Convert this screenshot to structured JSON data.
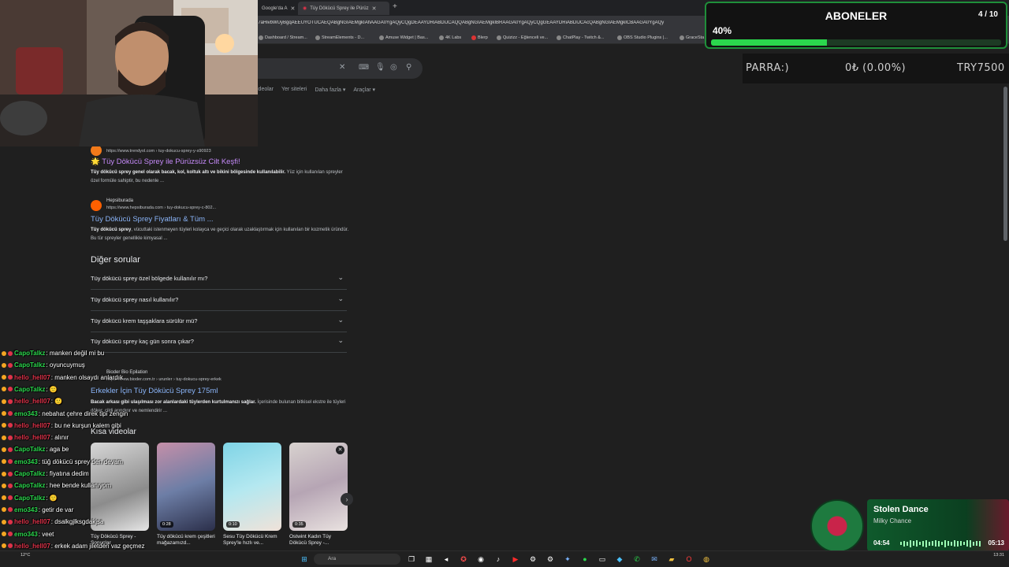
{
  "browser": {
    "tabs": [
      {
        "label": "Google'da A",
        "active": false
      },
      {
        "label": "Tüy Dökücü Sprey ile Pürüz",
        "active": true
      }
    ],
    "url": "j7aHivbWUyBgqAEEUYOTUCAEQABgNGIAEMgkIAhAAGA0YgAQyCQgDEAAYDRiABDIJCAQQABgNGIAEMgkIBRAAGA0YgAQyCQgGEAAYDRiABDIJCAcQABgNGIAEMgkICBAAGA0YgAQy",
    "bookmarks": [
      "Dashboard / Stream...",
      "StreamElements - D...",
      "Amuse Widget | Bas...",
      "4K Labs",
      "Blerp",
      "Quizizz - Eğlenceli ve...",
      "ChatPlay - Twitch &...",
      "OBS Studio Plugins |...",
      "GraceSta"
    ]
  },
  "google": {
    "tabs": [
      "ideolar",
      "Yer siteleri",
      "Daha fazla ▾",
      "Araçlar ▾"
    ],
    "results": [
      {
        "site": "Trendyol",
        "url": "https://www.trendyol.com › tuy-dokucu-sprey-y-s90923",
        "title": "🌟 Tüy Dökücü Sprey ile Pürüzsüz Cilt Keşfi!",
        "snippet_bold": "Tüy dökücü sprey genel olarak bacak, kol, koltuk altı ve bikini bölgesinde kullanılabilir.",
        "snippet_rest": " Yüz için kullanılan spreyler özel formüle sahiptir, bu nedenle ..."
      },
      {
        "site": "Hepsiburada",
        "url": "https://www.hepsiburada.com › tuy-dokucu-sprey-c-802...",
        "title": "Tüy Dökücü Sprey Fiyatları & Tüm ...",
        "snippet_bold": "Tüy dökücü sprey",
        "snippet_rest": ", vücuttaki istenmeyen tüyleri kolayca ve geçici olarak uzaklaştırmak için kullanılan bir kozmetik üründür. Bu tür spreyler genellikle kimyasal ..."
      },
      {
        "site": "Bioder Bio Epilation",
        "url": "https://www.bioder.com.tr › urunler › tuy-dokucu-sprey-erkek",
        "title": "Erkekler İçin Tüy Dökücü Sprey 175ml",
        "snippet_bold": "Bacak arkası gibi ulaşılması zor alanlardaki tüylerden kurtulmanızı sağlar.",
        "snippet_rest": " İçerisinde bulunan bitkisel ekstre ile tüyleri döker, cildi arındırır ve nemlendirir ..."
      }
    ],
    "paa_title": "Diğer sorular",
    "paa": [
      "Tüy dökücü sprey özel bölgede kullanılır mı?",
      "Tüy dökücü sprey nasıl kullanılır?",
      "Tüy dökücü krem taşşaklara sürülür mü?",
      "Tüy dökücü sprey kaç gün sonra çıkar?"
    ],
    "short_videos_title": "Kısa videolar",
    "videos": [
      {
        "caption": "Tüy Dökücü Sprey - Sonuçlar",
        "duration": ""
      },
      {
        "caption": "Tüy dökücü krem çeşitleri mağazamızd...",
        "duration": "0:28"
      },
      {
        "caption": "Sesu Tüy Dökücü Krem Sprey'le hızlı ve...",
        "duration": "0:10"
      },
      {
        "caption": "Ostwint Kadın Tüy Dökücü Sprey -...",
        "duration": "0:35"
      }
    ]
  },
  "sub_goal": {
    "title": "ABONELER",
    "count": "4 / 10",
    "percent_label": "40%",
    "progress": 0.4
  },
  "donation": {
    "label": "PARRA:)",
    "amount": "0₺ (0.00%)",
    "target": "TRY7500"
  },
  "chat": [
    {
      "user": "CapoTalkz",
      "color": "#2bd74d",
      "text": " : manken değil mi bu"
    },
    {
      "user": "CapoTalkz",
      "color": "#2bd74d",
      "text": " : oyuncuymuş"
    },
    {
      "user": "hello_hell07",
      "color": "#e0334a",
      "text": " : manken olsaydı anlardık"
    },
    {
      "user": "CapoTalkz",
      "color": "#2bd74d",
      "text": " : 🙂"
    },
    {
      "user": "hello_hell07",
      "color": "#e0334a",
      "text": " : 🙂"
    },
    {
      "user": "emo343",
      "color": "#2bd74d",
      "text": " : nebahat çehre direk tipi zengin"
    },
    {
      "user": "hello_hell07",
      "color": "#e0334a",
      "text": " : bu ne kurşun kalem gibi"
    },
    {
      "user": "hello_hell07",
      "color": "#e0334a",
      "text": " : alınır"
    },
    {
      "user": "CapoTalkz",
      "color": "#2bd74d",
      "text": " : aga be"
    },
    {
      "user": "emo343",
      "color": "#2bd74d",
      "text": " : tüğ dökücü sprey den devam"
    },
    {
      "user": "CapoTalkz",
      "color": "#2bd74d",
      "text": " : fiyatına dedim"
    },
    {
      "user": "CapoTalkz",
      "color": "#2bd74d",
      "text": " : hee bende kullanıyom"
    },
    {
      "user": "CapoTalkz",
      "color": "#2bd74d",
      "text": " : 🙂"
    },
    {
      "user": "emo343",
      "color": "#2bd74d",
      "text": " : getir de var"
    },
    {
      "user": "hello_hell07",
      "color": "#e0334a",
      "text": " : dsalkgjlksgdakjsa"
    },
    {
      "user": "emo343",
      "color": "#2bd74d",
      "text": " : veet"
    },
    {
      "user": "hello_hell07",
      "color": "#e0334a",
      "text": " : erkek adam jiletden vaz geçmez"
    },
    {
      "user": "hello_hell07",
      "color": "#e0334a",
      "text": " : 🙂"
    }
  ],
  "music": {
    "song": "Stolen Dance",
    "artist": "Milky Chance",
    "elapsed": "04:54",
    "total": "05:13",
    "progress": 0.94
  },
  "taskbar": {
    "search_label": "Ara",
    "weather": "12°C",
    "time": "13:31"
  }
}
